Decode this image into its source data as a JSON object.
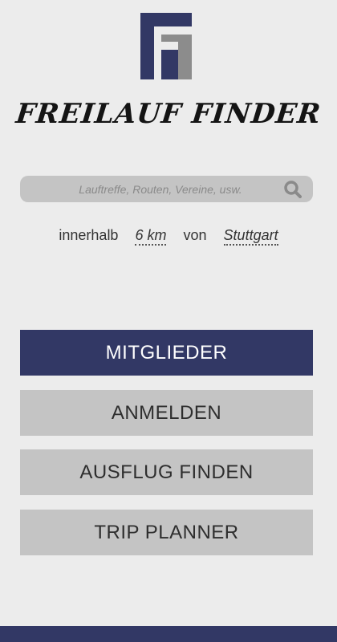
{
  "app": {
    "logo_icon": "ff-monogram-icon",
    "wordmark": "FREILAUF FINDER",
    "brand_color": "#323865"
  },
  "search": {
    "placeholder": "Lauftreffe, Routen, Vereine, usw.",
    "value": "",
    "icon": "search-icon"
  },
  "range": {
    "within_label": "innerhalb",
    "distance": "6 km",
    "from_label": "von",
    "location": "Stuttgart"
  },
  "menu": {
    "members_label": "MITGLIEDER",
    "login_label": "ANMELDEN",
    "find_trip_label": "AUSFLUG FINDEN",
    "trip_planner_label": "TRIP PLANNER"
  }
}
